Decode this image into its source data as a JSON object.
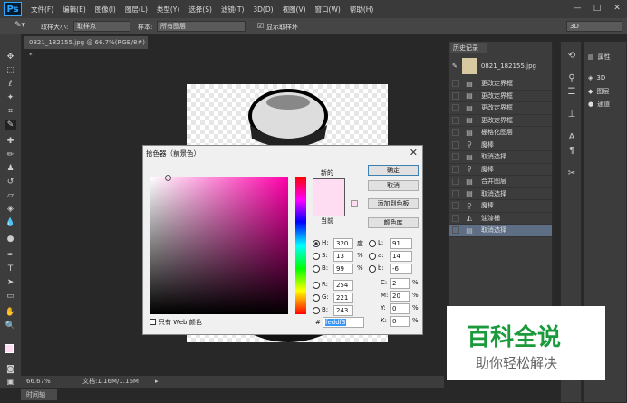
{
  "app": {
    "logo": "Ps",
    "menu": [
      "文件(F)",
      "编辑(E)",
      "图像(I)",
      "图层(L)",
      "类型(Y)",
      "选择(S)",
      "滤镜(T)",
      "3D(D)",
      "视图(V)",
      "窗口(W)",
      "帮助(H)"
    ],
    "win": [
      "—",
      "□",
      "✕"
    ]
  },
  "options": {
    "sample_size_label": "取样大小:",
    "sample_size": "取样点",
    "sample_label": "样本:",
    "sample": "所有图层",
    "show_ring": "显示取样环",
    "workspace": "3D"
  },
  "doc_tab": "0821_182155.jpg @ 66.7%(RGB/8#) *",
  "status": {
    "zoom": "66.67%",
    "doc": "文档:1.16M/1.16M",
    "timeline": "时间轴"
  },
  "history": {
    "title": "历史记录",
    "snapshot": "0821_182155.jpg",
    "items": [
      {
        "label": "更改定界框",
        "icon": "doc"
      },
      {
        "label": "更改定界框",
        "icon": "doc"
      },
      {
        "label": "更改定界框",
        "icon": "doc"
      },
      {
        "label": "更改定界框",
        "icon": "doc"
      },
      {
        "label": "栅格化图层",
        "icon": "doc"
      },
      {
        "label": "魔棒",
        "icon": "wand"
      },
      {
        "label": "取消选择",
        "icon": "doc"
      },
      {
        "label": "魔棒",
        "icon": "wand"
      },
      {
        "label": "合并图层",
        "icon": "doc"
      },
      {
        "label": "取消选择",
        "icon": "doc"
      },
      {
        "label": "魔棒",
        "icon": "wand"
      },
      {
        "label": "油漆桶",
        "icon": "bucket"
      },
      {
        "label": "取消选择",
        "icon": "doc"
      }
    ]
  },
  "right_panel": {
    "properties": "属性",
    "three_d": "3D",
    "layers": "图层",
    "channels": "通道"
  },
  "picker": {
    "title": "拾色器（前景色）",
    "new": "新的",
    "current": "当前",
    "ok": "确定",
    "cancel": "取消",
    "add_swatch": "添加到色板",
    "libraries": "颜色库",
    "web_only": "只有 Web 颜色",
    "hash": "#",
    "hex": "feddf3",
    "fields": {
      "H": "320",
      "S": "13",
      "B": "99",
      "R": "254",
      "G": "221",
      "Bl": "243",
      "L": "91",
      "a": "14",
      "b": "-6",
      "C": "2",
      "M": "20",
      "Y": "0",
      "K": "0"
    },
    "units": {
      "deg": "度",
      "pct": "%"
    },
    "labels": {
      "H": "H:",
      "S": "S:",
      "B": "B:",
      "R": "R:",
      "G": "G:",
      "Bl": "B:",
      "L": "L:",
      "a": "a:",
      "b": "b:",
      "C": "C:",
      "M": "M:",
      "Y": "Y:",
      "K": "K:"
    },
    "new_color": "#feddf3"
  },
  "watermark": {
    "title": "百科全说",
    "subtitle": "助你轻松解决"
  }
}
